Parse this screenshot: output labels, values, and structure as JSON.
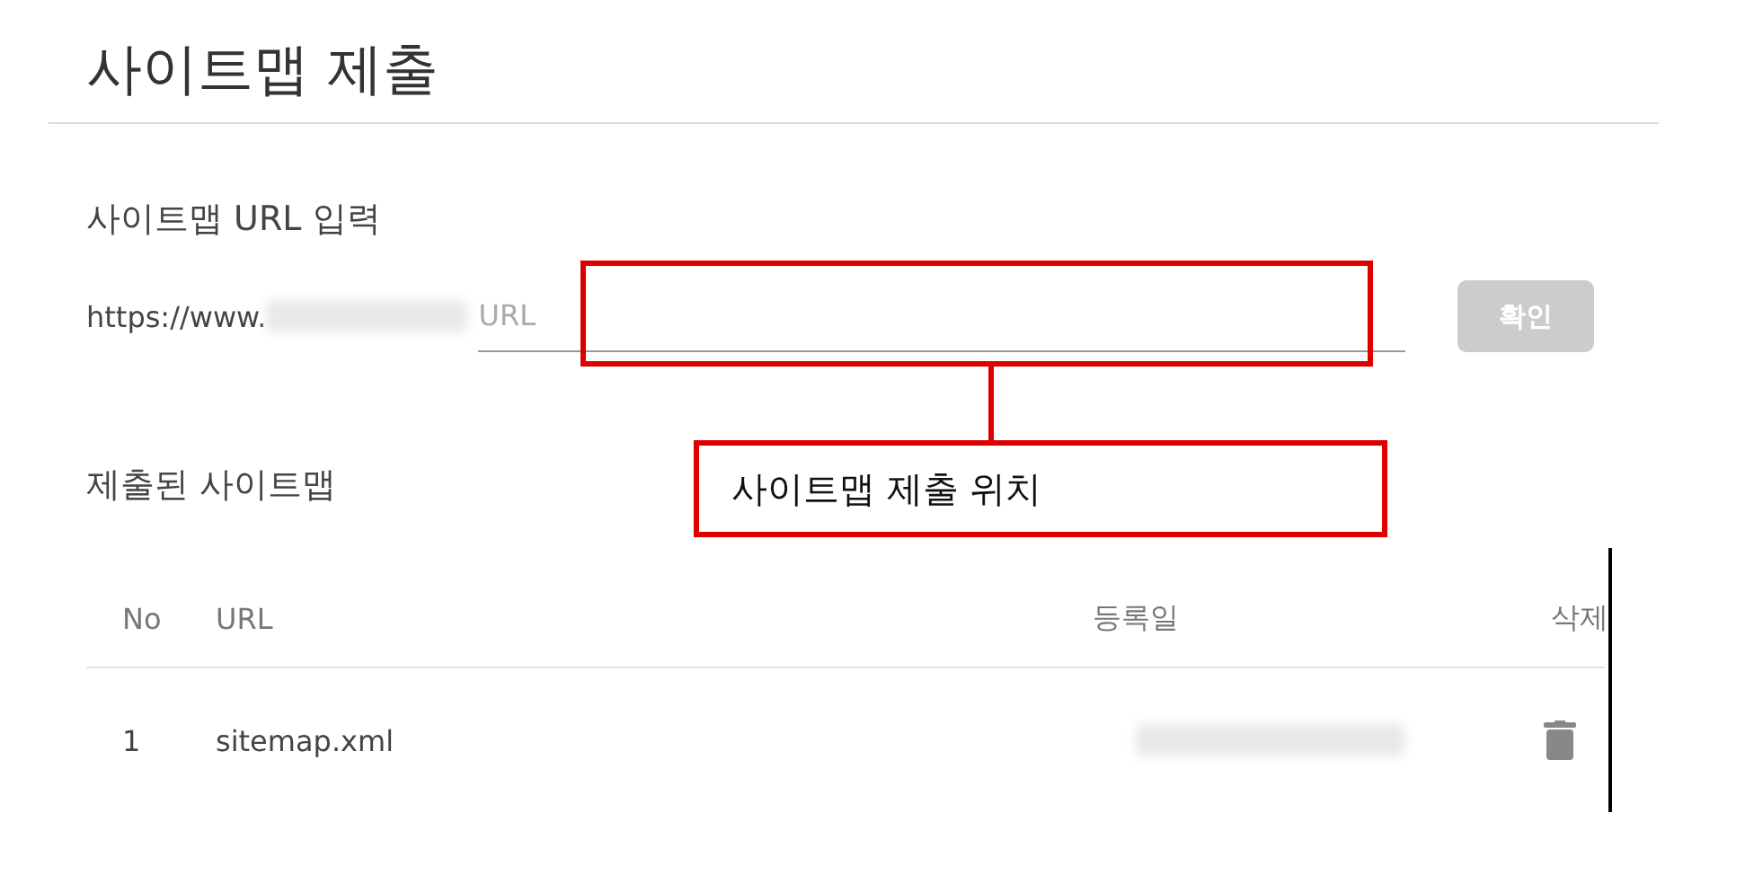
{
  "page": {
    "title": "사이트맵 제출"
  },
  "url_input": {
    "heading": "사이트맵 URL 입력",
    "prefix": "https://www.",
    "placeholder": "URL",
    "button": {
      "label": "확인",
      "disabled": true
    }
  },
  "submitted": {
    "heading": "제출된 사이트맵",
    "columns": [
      "No",
      "URL",
      "등록일",
      "삭제"
    ],
    "rows": [
      {
        "no": "1",
        "url": "sitemap.xml"
      }
    ]
  },
  "annotation": {
    "label": "사이트맵 제출 위치"
  }
}
